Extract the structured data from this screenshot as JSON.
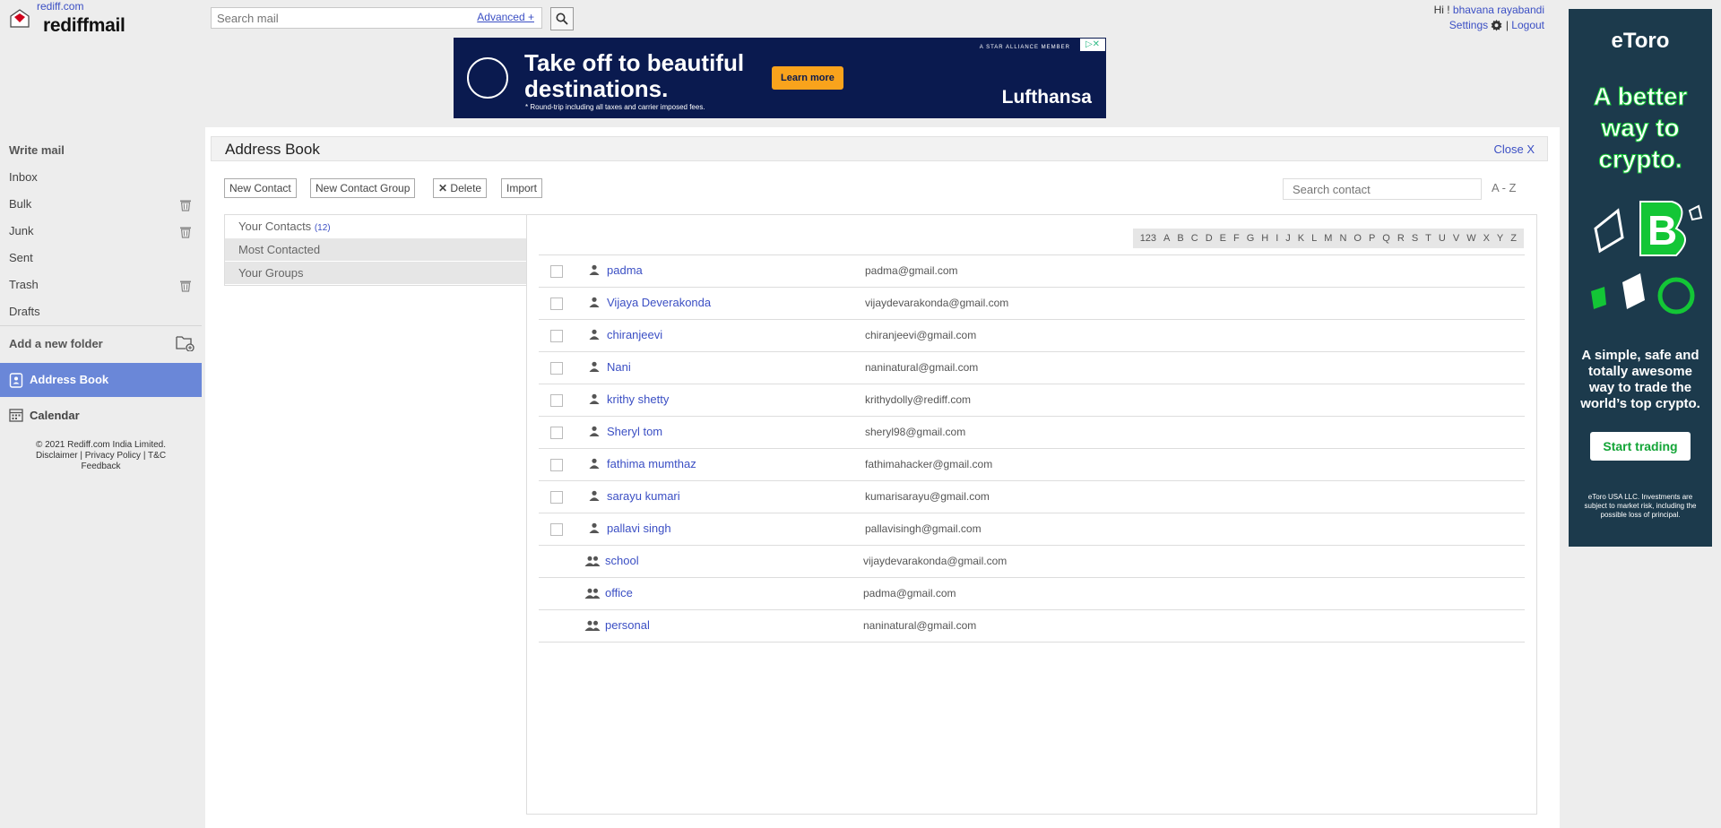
{
  "logo": {
    "small_text": "rediff.com",
    "name": "rediffmail"
  },
  "search": {
    "placeholder": "Search mail",
    "advanced_label": "Advanced +"
  },
  "user": {
    "greeting": "Hi !",
    "name": "bhavana rayabandi",
    "settings_label": "Settings",
    "separator": "|",
    "logout_label": "Logout"
  },
  "ad_banner": {
    "headline": "Take off to beautiful destinations.",
    "fine_print": "* Round-trip including all taxes and carrier imposed fees.",
    "cta": "Learn more",
    "brand": "Lufthansa",
    "alliance": "A STAR ALLIANCE MEMBER"
  },
  "nav": {
    "write_mail": "Write mail",
    "inbox": "Inbox",
    "bulk": "Bulk",
    "junk": "Junk",
    "sent": "Sent",
    "trash": "Trash",
    "drafts": "Drafts",
    "add_folder": "Add a new folder",
    "address_book": "Address Book",
    "calendar": "Calendar"
  },
  "footer": {
    "copyright": "© 2021 Rediff.com India Limited.",
    "disclaimer": "Disclaimer",
    "privacy": "Privacy Policy",
    "tc": "T&C",
    "feedback": "Feedback",
    "sep": "|"
  },
  "address_book": {
    "title": "Address Book",
    "close_label": "Close X",
    "buttons": {
      "new_contact": "New Contact",
      "new_group": "New Contact Group",
      "delete": "Delete",
      "import": "Import"
    },
    "search_placeholder": "Search contact",
    "sort_label": "A - Z",
    "menu": {
      "your_contacts": "Your Contacts",
      "your_contacts_count": "(12)",
      "most_contacted": "Most Contacted",
      "your_groups": "Your Groups"
    },
    "alphabet": [
      "123",
      "A",
      "B",
      "C",
      "D",
      "E",
      "F",
      "G",
      "H",
      "I",
      "J",
      "K",
      "L",
      "M",
      "N",
      "O",
      "P",
      "Q",
      "R",
      "S",
      "T",
      "U",
      "V",
      "W",
      "X",
      "Y",
      "Z"
    ],
    "contacts": [
      {
        "name": "padma",
        "email": "padma@gmail.com"
      },
      {
        "name": "Vijaya Deverakonda",
        "email": "vijaydevarakonda@gmail.com"
      },
      {
        "name": "chiranjeevi",
        "email": "chiranjeevi@gmail.com"
      },
      {
        "name": "Nani",
        "email": "naninatural@gmail.com"
      },
      {
        "name": "krithy shetty",
        "email": "krithydolly@rediff.com"
      },
      {
        "name": "Sheryl tom",
        "email": "sheryl98@gmail.com"
      },
      {
        "name": "fathima mumthaz",
        "email": "fathimahacker@gmail.com"
      },
      {
        "name": "sarayu kumari",
        "email": "kumarisarayu@gmail.com"
      },
      {
        "name": "pallavi singh",
        "email": "pallavisingh@gmail.com"
      }
    ],
    "groups": [
      {
        "name": "school",
        "email": "vijaydevarakonda@gmail.com"
      },
      {
        "name": "office",
        "email": "padma@gmail.com"
      },
      {
        "name": "personal",
        "email": "naninatural@gmail.com"
      }
    ]
  },
  "etoro_ad": {
    "logo": "eToro",
    "headline_lines": [
      "A better",
      "way to",
      "crypto."
    ],
    "sub": "A simple, safe and totally awesome way to trade the world’s top crypto.",
    "cta": "Start trading",
    "fine_print": "eToro USA LLC. Investments are subject to market risk, including the possible loss of principal.",
    "accent_color": "#13c636"
  },
  "colors": {
    "link": "#3b4fc4",
    "nav_active": "#6a87d8",
    "background": "#ededed"
  }
}
